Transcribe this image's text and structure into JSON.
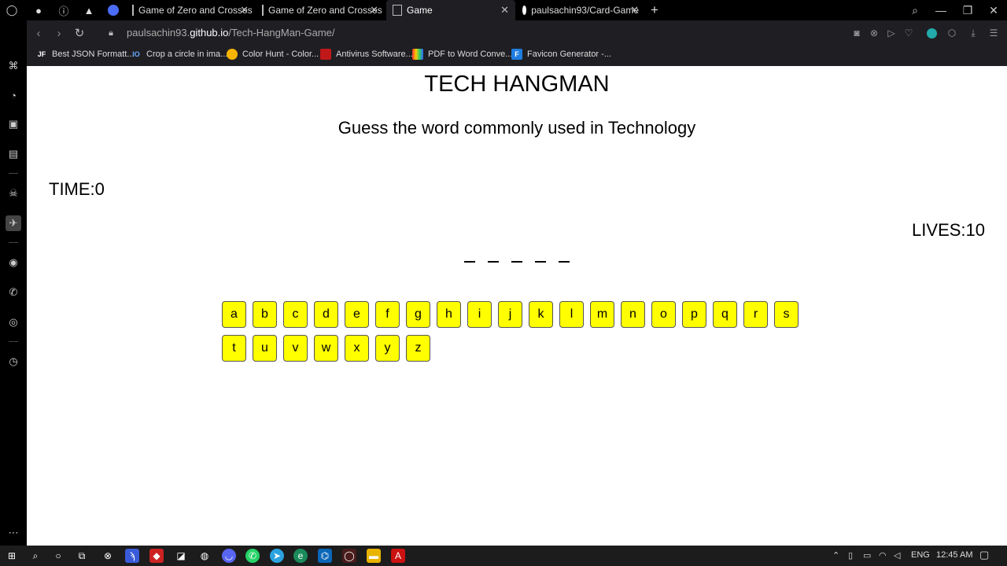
{
  "tabs": [
    {
      "title": "Game of Zero and Crosses"
    },
    {
      "title": "Game of Zero and Crosses"
    },
    {
      "title": "Game"
    },
    {
      "title": "paulsachin93/Card-Game"
    }
  ],
  "address": {
    "host_prefix": "paulsachin93.",
    "host_bold": "github.io",
    "path": "/Tech-HangMan-Game/"
  },
  "bookmarks": [
    {
      "label": "Best JSON Formatt...",
      "icon_text": "JF"
    },
    {
      "label": "Crop a circle in ima...",
      "icon_text": "IO"
    },
    {
      "label": "Color Hunt - Color...",
      "icon_text": ""
    },
    {
      "label": "Antivirus Software...",
      "icon_text": ""
    },
    {
      "label": "PDF to Word Conve...",
      "icon_text": ""
    },
    {
      "label": "Favicon Generator -...",
      "icon_text": "F"
    }
  ],
  "game": {
    "title": "TECH HANGMAN",
    "subtitle": "Guess the word commonly used in Technology",
    "time": "TIME:0",
    "lives": "LIVES:10",
    "blanks": 5,
    "letters": [
      "a",
      "b",
      "c",
      "d",
      "e",
      "f",
      "g",
      "h",
      "i",
      "j",
      "k",
      "l",
      "m",
      "n",
      "o",
      "p",
      "q",
      "r",
      "s",
      "t",
      "u",
      "v",
      "w",
      "x",
      "y",
      "z"
    ]
  },
  "tray": {
    "language": "ENG",
    "time": "12:45 AM"
  },
  "colors": {
    "letter_button": "#ffff00",
    "chrome_bg": "#1f1f23"
  }
}
